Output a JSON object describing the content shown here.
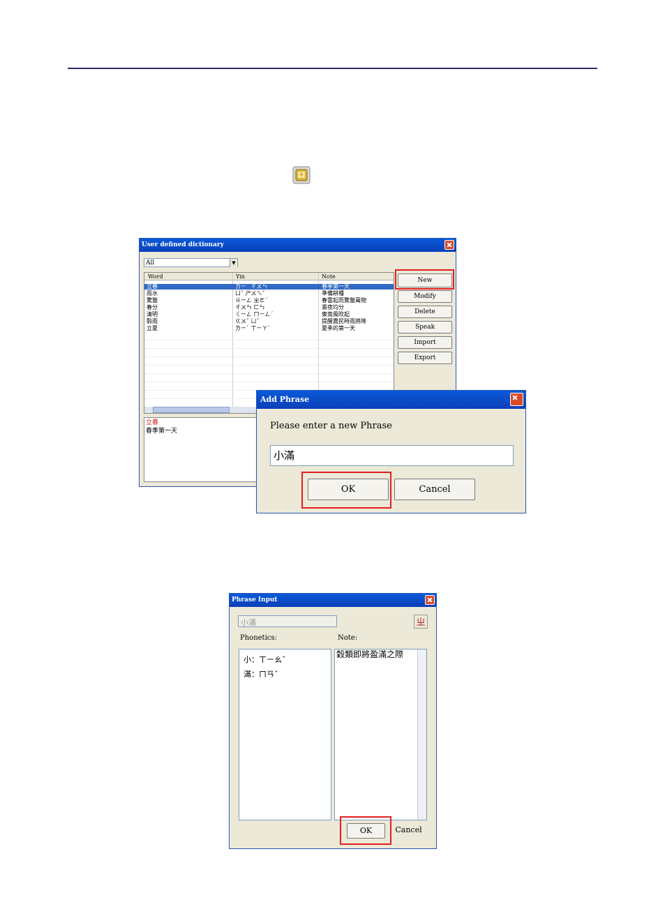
{
  "dictionary_window": {
    "title": "User defined dictionary",
    "filter_value": "All",
    "columns": [
      "Word",
      "Yin",
      "Note"
    ],
    "rows": [
      [
        "立春",
        "ㄌㄧˋ ㄔㄨㄣ",
        "春季第一天"
      ],
      [
        "雨水",
        "ㄩˇ ㄕㄨㄟˇ",
        "準備耕種"
      ],
      [
        "驚蟄",
        "ㄐㄧㄥ ㄓㄜˊ",
        "春雷起而驚蟄萬物"
      ],
      [
        "春分",
        "ㄔㄨㄣ ㄈㄣ",
        "晝夜均分"
      ],
      [
        "清明",
        "ㄑㄧㄥ ㄇㄧㄥˊ",
        "東南風吹起"
      ],
      [
        "穀雨",
        "ㄍㄨˇ ㄩˇ",
        "提醒農民時雨將降"
      ],
      [
        "立夏",
        "ㄌㄧˋ ㄒㄧㄚˋ",
        "夏季的第一天"
      ]
    ],
    "buttons": [
      "New",
      "Modify",
      "Delete",
      "Speak",
      "Import",
      "Export"
    ],
    "preview_word": "立春",
    "preview_note": "春季第一天"
  },
  "add_phrase_dialog": {
    "title": "Add Phrase",
    "prompt": "Please enter a new Phrase",
    "input_value": "小滿",
    "ok_label": "OK",
    "cancel_label": "Cancel"
  },
  "phrase_input_window": {
    "title": "Phrase Input",
    "phrase_value": "小滿",
    "phonetics_label": "Phonetics:",
    "note_label": "Note:",
    "phonetics": [
      "小：ㄒㄧㄠˇ",
      "滿：ㄇㄢˇ"
    ],
    "note_text": "穀類即將盈滿之際",
    "ok_label": "OK",
    "cancel_label": "Cancel"
  },
  "colors": {
    "title_bar": "#0a4fc8",
    "window_face": "#ece9d8",
    "highlight": "#e02020",
    "selected_row": "#316ac5",
    "top_rule": "#2b2b6b"
  },
  "icons": [
    "dictionary-book-icon",
    "close-icon",
    "dropdown-arrow-icon",
    "speak-phonetic-icon"
  ]
}
